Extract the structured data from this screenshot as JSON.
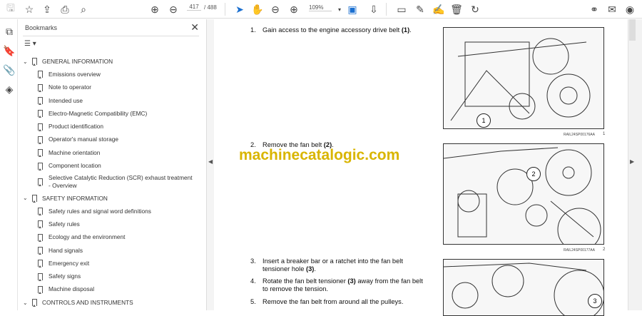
{
  "toolbar": {
    "page_current": "417",
    "page_total": "/ 488",
    "zoom": "109%"
  },
  "bookmarks": {
    "title": "Bookmarks",
    "close": "✕",
    "options": "☰ ▾",
    "items": [
      {
        "label": "GENERAL INFORMATION",
        "level": 1
      },
      {
        "label": "Emissions overview",
        "level": 2
      },
      {
        "label": "Note to operator",
        "level": 2
      },
      {
        "label": "Intended use",
        "level": 2
      },
      {
        "label": "Electro-Magnetic Compatibility (EMC)",
        "level": 2
      },
      {
        "label": "Product identification",
        "level": 2
      },
      {
        "label": "Operator's manual storage",
        "level": 2
      },
      {
        "label": "Machine orientation",
        "level": 2
      },
      {
        "label": "Component location",
        "level": 2
      },
      {
        "label": "Selective Catalytic Reduction (SCR) exhaust treatment - Overview",
        "level": 2
      },
      {
        "label": "SAFETY INFORMATION",
        "level": 1
      },
      {
        "label": "Safety rules and signal word definitions",
        "level": 2
      },
      {
        "label": "Safety rules",
        "level": 2
      },
      {
        "label": "Ecology and the environment",
        "level": 2
      },
      {
        "label": "Hand signals",
        "level": 2
      },
      {
        "label": "Emergency exit",
        "level": 2
      },
      {
        "label": "Safety signs",
        "level": 2
      },
      {
        "label": "Machine disposal",
        "level": 2
      },
      {
        "label": "CONTROLS AND INSTRUMENTS",
        "level": 1
      }
    ]
  },
  "document": {
    "steps": [
      {
        "n": "1.",
        "text": "Gain access to the engine accessory drive belt ",
        "bold": "(1)",
        "after": "."
      },
      {
        "n": "2.",
        "text": "Remove the fan belt ",
        "bold": "(2)",
        "after": "."
      },
      {
        "n": "3.",
        "text": "Insert a breaker bar or a ratchet into the fan belt tensioner hole ",
        "bold": "(3)",
        "after": "."
      },
      {
        "n": "4.",
        "text": "Rotate the fan belt tensioner ",
        "bold": "(3)",
        "after": " away from the fan belt to remove the tension."
      },
      {
        "n": "5.",
        "text": "Remove the fan belt from around all the pulleys.",
        "bold": "",
        "after": ""
      }
    ],
    "figures": [
      {
        "code": "RAIL24SP00176AA",
        "num": "1",
        "callout": "1"
      },
      {
        "code": "RAIL24SP00177AA",
        "num": "2",
        "callout": "2"
      },
      {
        "callout": "3"
      }
    ],
    "watermark": "machinecatalogic.com"
  }
}
